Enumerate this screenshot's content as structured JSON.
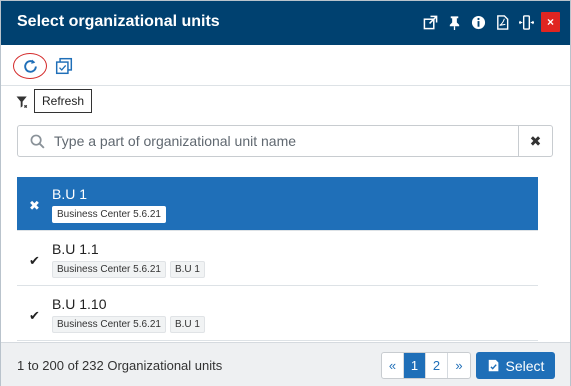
{
  "dialog": {
    "title": "Select organizational units",
    "close_label": "×"
  },
  "toolbar": {
    "tooltip": "Refresh"
  },
  "search": {
    "placeholder": "Type a part of organizational unit name",
    "clear_label": "✖"
  },
  "list": {
    "items": [
      {
        "name": "B.U 1",
        "mark": "✖",
        "selected": true,
        "tags": [
          "Business Center 5.6.21"
        ]
      },
      {
        "name": "B.U 1.1",
        "mark": "✔",
        "selected": false,
        "tags": [
          "Business Center 5.6.21",
          "B.U 1"
        ]
      },
      {
        "name": "B.U 1.10",
        "mark": "✔",
        "selected": false,
        "tags": [
          "Business Center 5.6.21",
          "B.U 1"
        ]
      }
    ]
  },
  "footer": {
    "count_text": "1 to 200 of 232 Organizational units",
    "pager": {
      "prev": "«",
      "pages": [
        "1",
        "2"
      ],
      "active": "1",
      "next": "»"
    },
    "select_label": "Select"
  },
  "colors": {
    "titlebar": "#004170",
    "accent": "#1f6fb8",
    "close": "#e02521"
  }
}
